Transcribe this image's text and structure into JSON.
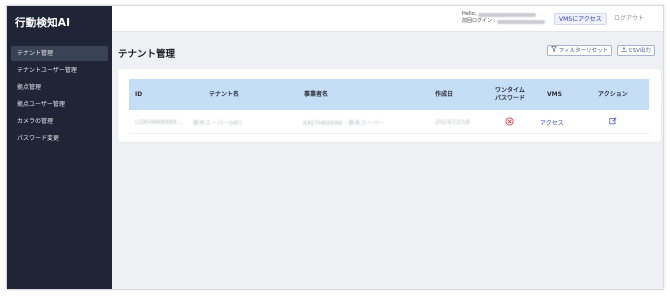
{
  "app": {
    "title": "行動検知AI"
  },
  "sidebar": {
    "items": [
      {
        "label": "テナント管理",
        "active": true
      },
      {
        "label": "テナントユーザー管理",
        "active": false
      },
      {
        "label": "拠点管理",
        "active": false
      },
      {
        "label": "拠点ユーザー管理",
        "active": false
      },
      {
        "label": "カメラの管理",
        "active": false
      },
      {
        "label": "パスワード変更",
        "active": false
      }
    ]
  },
  "header": {
    "hello_label": "Hello,",
    "last_login_label": "前回ログイン :",
    "vms_button": "VMSにアクセス",
    "logout_button": "ログアウト"
  },
  "main": {
    "page_title": "テナント管理",
    "filter_reset_button": "フィルターリセット",
    "csv_button": "CSV出力",
    "table": {
      "columns": [
        "ID",
        "テナント名",
        "事業者名",
        "作成日",
        "ワンタイム\nパスワード",
        "VMS",
        "アクション"
      ],
      "rows": [
        {
          "id": "LGKHWKKKKK...",
          "tenant_name": "新木スーパー(HF)",
          "company_name": "KAETHKKKKK - 新木スーパー",
          "created": "2024/12/18",
          "otp_icon": "x-circle-icon",
          "vms_link": "アクセス",
          "action_icon": "edit-icon"
        }
      ]
    }
  },
  "colors": {
    "sidebar_bg": "#1f2537",
    "active_item_bg": "#3a4256",
    "table_header_bg": "#c6ddf6",
    "link": "#3a48c7",
    "danger": "#e0424a"
  }
}
